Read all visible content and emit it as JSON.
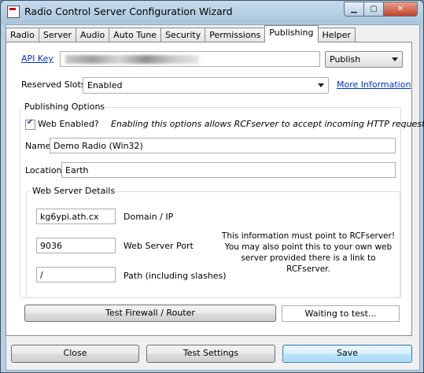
{
  "window": {
    "title": "Radio Control Server Configuration Wizard"
  },
  "tabs": [
    "Radio",
    "Server",
    "Audio",
    "Auto Tune",
    "Security",
    "Permissions",
    "Publishing",
    "Helper"
  ],
  "active_tab": "Publishing",
  "api_key": {
    "label": "API Key",
    "value": ""
  },
  "publish_combo": {
    "value": "Publish"
  },
  "reserved_slots": {
    "label": "Reserved Slots",
    "value": "Enabled",
    "more_info": "More Information"
  },
  "publishing_options": {
    "title": "Publishing Options",
    "web_enabled": {
      "label": "Web Enabled?",
      "checked": true,
      "hint": "Enabling this options allows RCFserver to accept incoming HTTP requests."
    },
    "name": {
      "label": "Name",
      "value": "Demo Radio (Win32)"
    },
    "location": {
      "label": "Location",
      "value": "Earth"
    }
  },
  "web_server": {
    "title": "Web Server Details",
    "domain": {
      "value": "kg6ypi.ath.cx",
      "label": "Domain / IP"
    },
    "port": {
      "value": "9036",
      "label": "Web Server Port"
    },
    "path": {
      "value": "/",
      "label": "Path (including slashes)"
    },
    "info": "This information must point to RCFserver! You may also point this to your own web server provided there is a link to RCFserver."
  },
  "test": {
    "button": "Test Firewall / Router",
    "status": "Waiting to test..."
  },
  "footer": {
    "close": "Close",
    "test_settings": "Test Settings",
    "save": "Save"
  }
}
